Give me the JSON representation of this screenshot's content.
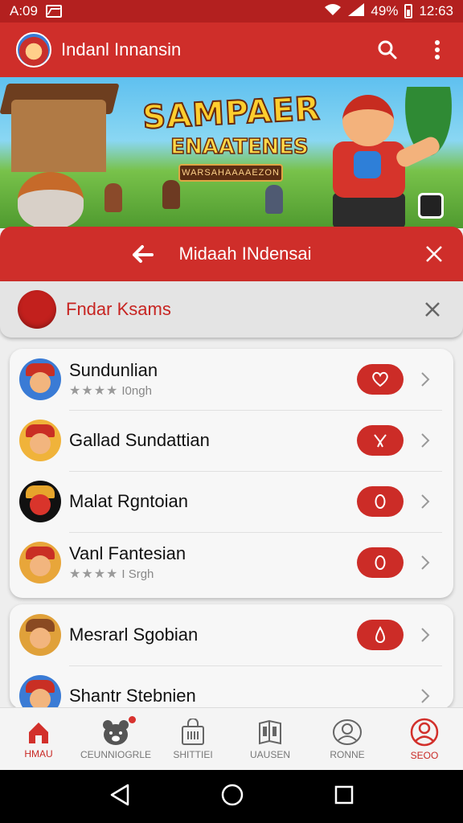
{
  "status_bar": {
    "time_left": "A:09",
    "battery_text": "49%",
    "clock": "12:63"
  },
  "app_bar": {
    "title": "Indanl Innansin",
    "logo_icon": "game-logo-icon",
    "search_icon": "search-icon",
    "menu_icon": "more-vert-icon"
  },
  "banner": {
    "title": "SAMPAER",
    "subtitle": "ENAATENES",
    "tag": "WARSAHAAAAEZON"
  },
  "selection_bar": {
    "label": "Midaah INdensai",
    "back_icon": "back-arrow-icon",
    "close_icon": "close-icon"
  },
  "filter_chip": {
    "label": "Fndar Ksams",
    "close_icon": "close-icon"
  },
  "games": [
    {
      "title": "Sundunlian",
      "subtitle": "I0ngh",
      "stars": "★★★★",
      "action_icon": "heart-icon",
      "avatar_bg": "#3a7bd5"
    },
    {
      "title": "Gallad Sundattian",
      "subtitle": "",
      "stars": "",
      "action_icon": "sword-icon",
      "avatar_bg": "#f0b33a"
    },
    {
      "title": "Malat Rgntoian",
      "subtitle": "",
      "stars": "",
      "action_icon": "zero-icon",
      "avatar_bg": "#111111"
    },
    {
      "title": "Vanl Fantesian",
      "subtitle": "I Srgh",
      "stars": "★★★★",
      "action_icon": "zero-icon",
      "avatar_bg": "#e8a63a"
    },
    {
      "title": "Mesrarl Sgobian",
      "subtitle": "",
      "stars": "",
      "action_icon": "drop-icon",
      "avatar_bg": "#e0a13a"
    },
    {
      "title": "Shantr Stebnien",
      "subtitle": "",
      "stars": "",
      "action_icon": "",
      "avatar_bg": "#3a7bd5"
    }
  ],
  "bottom_nav": [
    {
      "label": "HMAU",
      "icon": "home-icon",
      "active": true
    },
    {
      "label": "CEUNNIOGRLE",
      "icon": "bear-icon",
      "active": false
    },
    {
      "label": "SHITTIEI",
      "icon": "shopping-bag-icon",
      "active": false
    },
    {
      "label": "UAUSEN",
      "icon": "book-icon",
      "active": false
    },
    {
      "label": "RONNE",
      "icon": "profile-icon",
      "active": false
    },
    {
      "label": "SEOO",
      "icon": "account-icon",
      "active": true
    }
  ],
  "colors": {
    "primary": "#cf2e2a",
    "dark_primary": "#b3201f",
    "accent": "#c72421"
  }
}
